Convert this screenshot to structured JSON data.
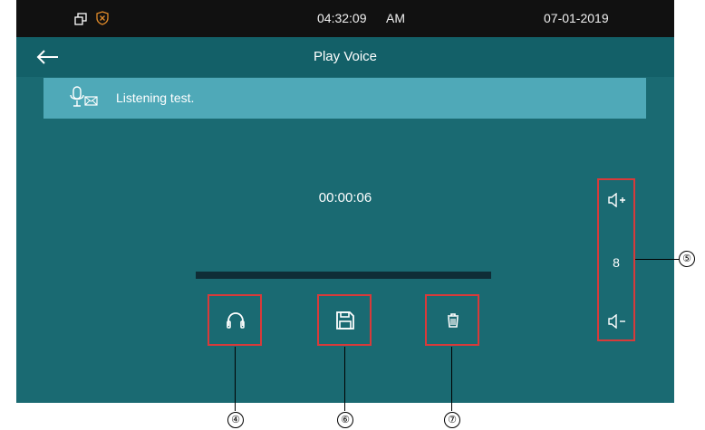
{
  "status_bar": {
    "time": "04:32:09",
    "ampm": "AM",
    "date": "07-01-2019",
    "icons": [
      "copy-icon",
      "shield-icon"
    ]
  },
  "title_bar": {
    "title": "Play Voice",
    "back_icon": "back-arrow-icon"
  },
  "message": {
    "icon": "voice-message-icon",
    "text": "Listening test."
  },
  "player": {
    "elapsed": "00:00:06",
    "progress_fraction": 0.0
  },
  "actions": [
    {
      "name": "listen",
      "icon": "headphones-icon"
    },
    {
      "name": "save",
      "icon": "save-icon"
    },
    {
      "name": "delete",
      "icon": "trash-icon"
    }
  ],
  "volume": {
    "level": "8",
    "up_icon": "volume-up-icon",
    "down_icon": "volume-down-icon"
  },
  "callouts": {
    "listen": "④",
    "volume": "⑤",
    "save": "⑥",
    "delete": "⑦"
  },
  "colors": {
    "screen_bg": "#1a6a72",
    "title_bg": "#136068",
    "banner_bg": "#4fa9b8",
    "highlight": "#d83a3a",
    "progress_track": "#0f2d36"
  }
}
